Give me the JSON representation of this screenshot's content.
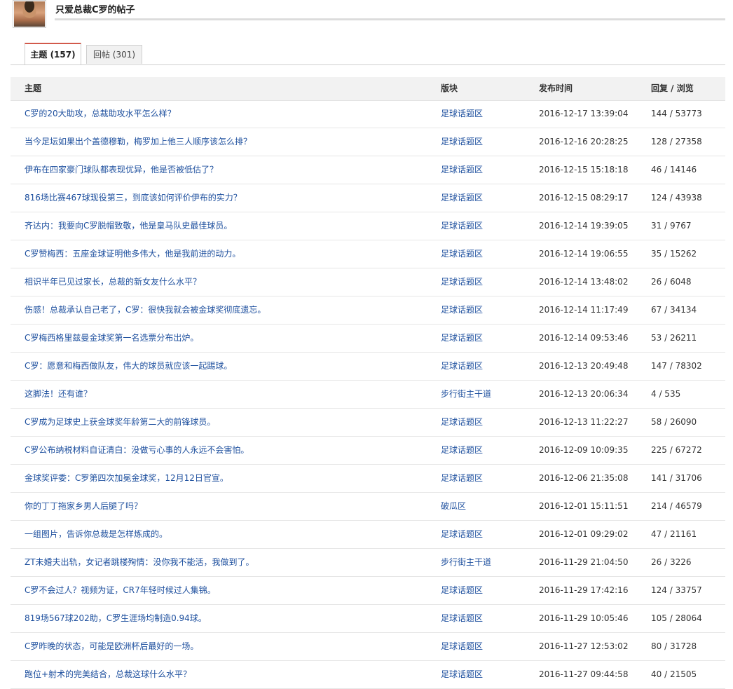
{
  "header": {
    "title": "只爱总裁C罗的帖子"
  },
  "tabs": [
    {
      "label": "主题 (157)",
      "active": true
    },
    {
      "label": "回帖 (301)",
      "active": false
    }
  ],
  "table": {
    "columns": [
      "主题",
      "版块",
      "发布时间",
      "回复 / 浏览"
    ],
    "rows": [
      {
        "subject": "C罗的20大助攻，总裁助攻水平怎么样？",
        "forum": "足球话题区",
        "time": "2016-12-17 13:39:04",
        "stats": "144 / 53773"
      },
      {
        "subject": "当今足坛如果出个盖德穆勒，梅罗加上他三人顺序该怎么排？",
        "forum": "足球话题区",
        "time": "2016-12-16 20:28:25",
        "stats": "128 / 27358"
      },
      {
        "subject": "伊布在四家豪门球队都表现优异，他是否被低估了？",
        "forum": "足球话题区",
        "time": "2016-12-15 15:18:18",
        "stats": "46 / 14146"
      },
      {
        "subject": "816场比赛467球现役第三，到底该如何评价伊布的实力？",
        "forum": "足球话题区",
        "time": "2016-12-15 08:29:17",
        "stats": "124 / 43938"
      },
      {
        "subject": "齐达内：我要向C罗脱帽致敬，他是皇马队史最佳球员。",
        "forum": "足球话题区",
        "time": "2016-12-14 19:39:05",
        "stats": "31 / 9767"
      },
      {
        "subject": "C罗赞梅西：五座金球证明他多伟大，他是我前进的动力。",
        "forum": "足球话题区",
        "time": "2016-12-14 19:06:55",
        "stats": "35 / 15262"
      },
      {
        "subject": "相识半年已见过家长，总裁的新女友什么水平？",
        "forum": "足球话题区",
        "time": "2016-12-14 13:48:02",
        "stats": "26 / 6048"
      },
      {
        "subject": "伤感！总裁承认自己老了，C罗：很快我就会被金球奖彻底遗忘。",
        "forum": "足球话题区",
        "time": "2016-12-14 11:17:49",
        "stats": "67 / 34134"
      },
      {
        "subject": "C罗梅西格里兹曼金球奖第一名选票分布出炉。",
        "forum": "足球话题区",
        "time": "2016-12-14 09:53:46",
        "stats": "53 / 26211"
      },
      {
        "subject": "C罗：愿意和梅西做队友，伟大的球员就应该一起踢球。",
        "forum": "足球话题区",
        "time": "2016-12-13 20:49:48",
        "stats": "147 / 78302"
      },
      {
        "subject": "这脚法！还有谁？",
        "forum": "步行街主干道",
        "time": "2016-12-13 20:06:34",
        "stats": "4 / 535"
      },
      {
        "subject": "C罗成为足球史上获金球奖年龄第二大的前锋球员。",
        "forum": "足球话题区",
        "time": "2016-12-13 11:22:27",
        "stats": "58 / 26090"
      },
      {
        "subject": "C罗公布纳税材料自证清白：没做亏心事的人永远不会害怕。",
        "forum": "足球话题区",
        "time": "2016-12-09 10:09:35",
        "stats": "225 / 67272"
      },
      {
        "subject": "金球奖评委：C罗第四次加冕金球奖，12月12日官宣。",
        "forum": "足球话题区",
        "time": "2016-12-06 21:35:08",
        "stats": "141 / 31706"
      },
      {
        "subject": "你的丁丁拖家乡男人后腿了吗？",
        "forum": "破瓜区",
        "time": "2016-12-01 15:11:51",
        "stats": "214 / 46579"
      },
      {
        "subject": "一组图片，告诉你总裁是怎样炼成的。",
        "forum": "足球话题区",
        "time": "2016-12-01 09:29:02",
        "stats": "47 / 21161"
      },
      {
        "subject": "ZT未婚夫出轨，女记者跳楼殉情：没你我不能活，我做到了。",
        "forum": "步行街主干道",
        "time": "2016-11-29 21:04:50",
        "stats": "26 / 3226"
      },
      {
        "subject": "C罗不会过人？视频为证，CR7年轻时候过人集锦。",
        "forum": "足球话题区",
        "time": "2016-11-29 17:42:16",
        "stats": "124 / 33757"
      },
      {
        "subject": "819场567球202助，C罗生涯场均制造0.94球。",
        "forum": "足球话题区",
        "time": "2016-11-29 10:05:46",
        "stats": "105 / 28064"
      },
      {
        "subject": "C罗昨晚的状态，可能是欧洲杯后最好的一场。",
        "forum": "足球话题区",
        "time": "2016-11-27 12:53:02",
        "stats": "80 / 31728"
      },
      {
        "subject": "跑位+射术的完美结合，总裁这球什么水平？",
        "forum": "足球话题区",
        "time": "2016-11-27 09:44:58",
        "stats": "40 / 21505"
      }
    ]
  }
}
